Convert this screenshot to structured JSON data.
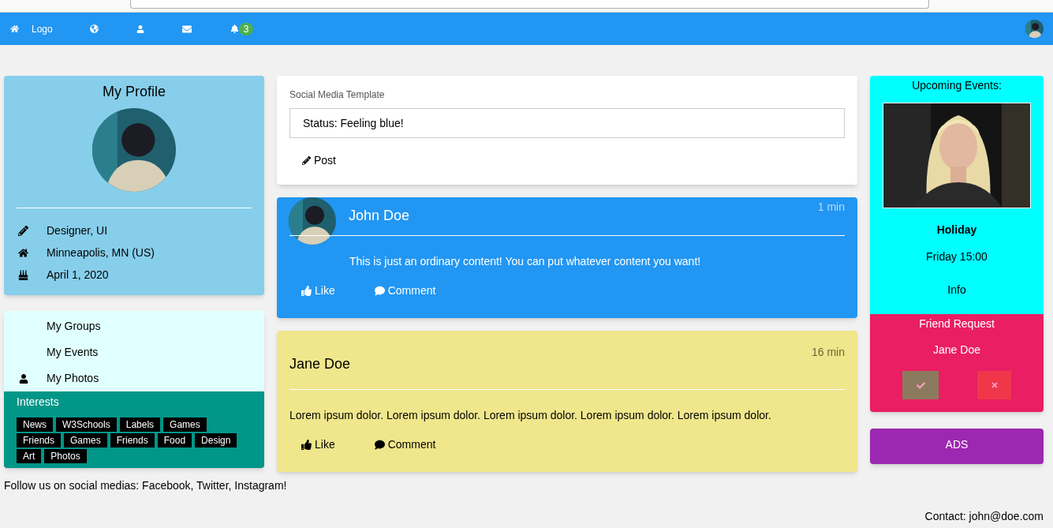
{
  "navbar": {
    "logo": "Logo",
    "notification_count": "3"
  },
  "profile": {
    "title": "My Profile",
    "details": [
      {
        "kind": "job",
        "text": "Designer, UI"
      },
      {
        "kind": "home",
        "text": "Minneapolis, MN (US)"
      },
      {
        "kind": "birthday",
        "text": "April 1, 2020"
      }
    ]
  },
  "menu": [
    {
      "kind": "plain",
      "label": "My Groups"
    },
    {
      "kind": "plain",
      "label": "My Events"
    },
    {
      "kind": "photos",
      "label": "My Photos"
    }
  ],
  "interests": {
    "title": "Interests",
    "tags": [
      "News",
      "W3Schools",
      "Labels",
      "Games",
      "Friends",
      "Games",
      "Friends",
      "Food",
      "Design",
      "Art",
      "Photos"
    ]
  },
  "status": {
    "label": "Social Media Template",
    "value": "Status: Feeling blue!",
    "button": "Post"
  },
  "posts": [
    {
      "kind": "blue",
      "author": "John Doe",
      "time": "1 min",
      "avatar": true,
      "content": "This is just an ordinary content! You can put whatever content you want!",
      "like": "Like",
      "comment": "Comment"
    },
    {
      "kind": "yellow",
      "author": "Jane Doe",
      "time": "16 min",
      "avatar": false,
      "content": "Lorem ipsum dolor. Lorem ipsum dolor. Lorem ipsum dolor. Lorem ipsum dolor. Lorem ipsum dolor.",
      "like": "Like",
      "comment": "Comment"
    }
  ],
  "events": {
    "title": "Upcoming Events:",
    "name": "Holiday",
    "time": "Friday 15:00",
    "info": "Info"
  },
  "friend_request": {
    "title": "Friend Request",
    "name": "Jane Doe"
  },
  "ads": "ADS",
  "footer": {
    "follow": "Follow us on social medias: Facebook, Twitter, Instagram!",
    "contact": "Contact: john@doe.com"
  }
}
